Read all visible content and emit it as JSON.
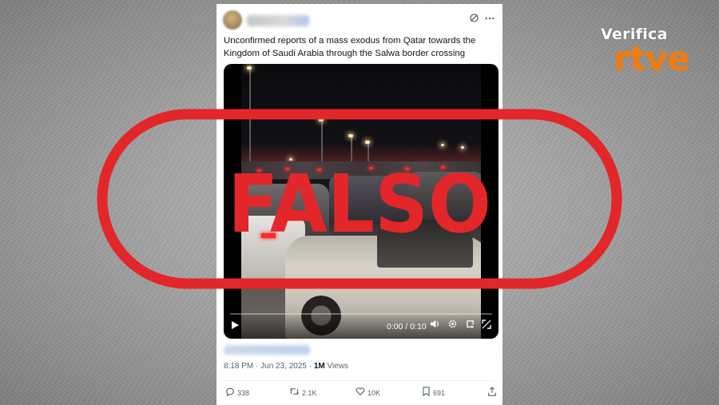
{
  "brand": {
    "verifica": "Verifica",
    "rtve": "rtve",
    "accent_color": "#f07c10"
  },
  "tweet": {
    "text": "Unconfirmed reports of a mass exodus from Qatar towards the Kingdom of Saudi Arabia through the Salwa border crossing",
    "header_icons": [
      "grok-icon",
      "more-icon"
    ],
    "video": {
      "time": "0:00 / 0:10",
      "controls": [
        "play-icon",
        "volume-icon",
        "settings-icon",
        "loop-icon",
        "fullscreen-icon"
      ]
    },
    "meta": {
      "time": "8:18 PM",
      "sep": " · ",
      "date": "Jun 23, 2025",
      "sep2": " · ",
      "views_count": "1M",
      "views_label": " Views"
    },
    "actions": {
      "replies": "338",
      "reposts": "2.1K",
      "likes": "10K",
      "bookmarks": "691"
    }
  },
  "stamp": {
    "label": "FALSO",
    "color": "#e3262a"
  }
}
